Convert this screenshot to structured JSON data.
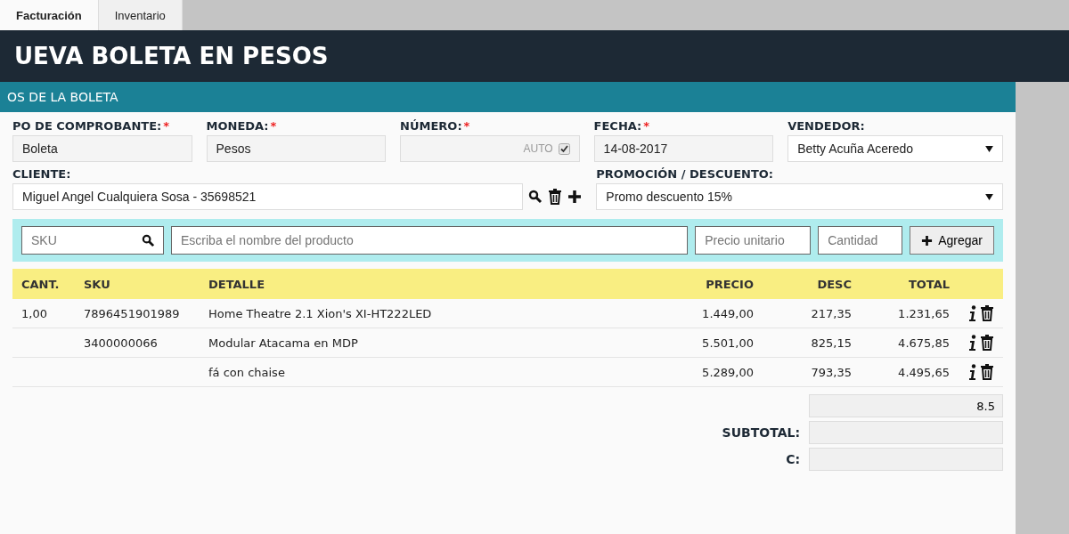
{
  "tabs": [
    {
      "label": "Facturación",
      "selected": true
    },
    {
      "label": "Inventario",
      "selected": false
    }
  ],
  "title": "UEVA BOLETA EN PESOS",
  "section_title": "OS DE LA BOLETA",
  "fields": [
    {
      "kind": "text",
      "label": "PO DE COMPROBANTE:",
      "required_mark": "*",
      "value": "Boleta"
    },
    {
      "kind": "text",
      "label": "MONEDA:",
      "required_mark": "*",
      "value": "Pesos"
    },
    {
      "kind": "auto",
      "label": "NÚMERO:",
      "required_mark": "*",
      "checkbox_label": "AUTO",
      "checked": true
    },
    {
      "kind": "text",
      "label": "FECHA:",
      "required_mark": "*",
      "value": "14-08-2017"
    },
    {
      "kind": "select",
      "label": "VENDEDOR:",
      "value": "Betty Acuña Aceredo"
    }
  ],
  "cliente": {
    "label": "CLIENTE:",
    "value": "Miguel Angel Cualquiera Sosa - 35698521"
  },
  "promocion": {
    "label": "PROMOCIÓN / DESCUENTO:",
    "value": "Promo descuento 15%"
  },
  "entry": {
    "sku_placeholder": "SKU",
    "product_placeholder": "Escriba el nombre del producto",
    "price_placeholder": "Precio unitario",
    "qty_placeholder": "Cantidad",
    "button": "Agregar"
  },
  "table": {
    "columns": [
      "CANT.",
      "SKU",
      "DETALLE",
      "PRECIO",
      "DESC",
      "TOTAL"
    ],
    "rows": [
      [
        "1,00",
        "7896451901989",
        "Home Theatre 2.1 Xion's XI-HT222LED",
        "1.449,00",
        "217,35",
        "1.231,65"
      ],
      [
        "",
        "3400000066",
        "Modular Atacama en MDP",
        "5.501,00",
        "825,15",
        "4.675,85"
      ],
      [
        "",
        "",
        "fá con chaise",
        "5.289,00",
        "793,35",
        "4.495,65"
      ]
    ]
  },
  "totals": [
    {
      "value": "8.5"
    },
    {
      "label": "SUBTOTAL:"
    },
    {
      "label": "C:"
    }
  ]
}
